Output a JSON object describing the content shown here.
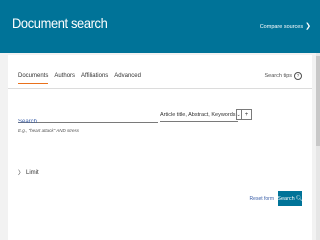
{
  "header": {
    "title": "Document search",
    "compare_sources_label": "Compare sources",
    "compare_chevron": "❯"
  },
  "tabs": [
    {
      "label": "Documents",
      "active": true
    },
    {
      "label": "Authors",
      "active": false
    },
    {
      "label": "Affiliations",
      "active": false
    },
    {
      "label": "Advanced",
      "active": false
    }
  ],
  "search_tips": {
    "label": "Search tips",
    "icon": "?"
  },
  "search": {
    "placeholder": "Search",
    "value": "",
    "hint": "E.g., \"heart attack\" AND stress"
  },
  "field_select": {
    "label": "Article title, Abstract, Keywords",
    "caret": "⌄"
  },
  "add_field": {
    "symbol": "+"
  },
  "limit": {
    "chevron": "〉",
    "label": "Limit"
  },
  "actions": {
    "reset_label": "Reset form",
    "search_label": "Search",
    "search_icon": "🔍︎"
  },
  "colors": {
    "header": "#007398",
    "accent": "#e9711c",
    "link": "#3a5ea8",
    "button": "#007398"
  }
}
